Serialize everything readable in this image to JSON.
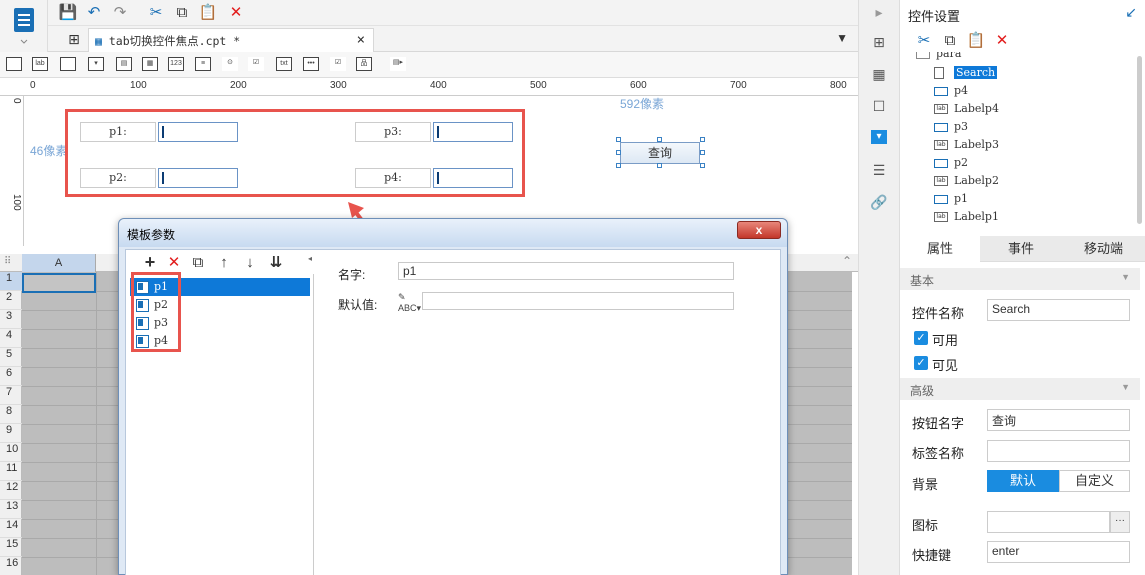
{
  "document_tab": {
    "label": "tab切换控件焦点.cpt *",
    "close": "×"
  },
  "ruler": {
    "ticks": [
      "0",
      "100",
      "200",
      "300",
      "400",
      "500",
      "600",
      "700",
      "800"
    ],
    "vticks": [
      "0",
      "100"
    ]
  },
  "design": {
    "hint_width": "592像素",
    "hint_height": "46像素",
    "params": [
      {
        "label": "p1:"
      },
      {
        "label": "p3:"
      },
      {
        "label": "p2:"
      },
      {
        "label": "p4:"
      }
    ],
    "query_button": "查询"
  },
  "grid": {
    "column": "A",
    "rows": [
      "1",
      "2",
      "3",
      "4",
      "5",
      "6",
      "7",
      "8",
      "9",
      "10",
      "11",
      "12",
      "13",
      "14",
      "15",
      "16"
    ]
  },
  "dialog": {
    "title": "模板参数",
    "close": "x",
    "params": [
      "p1",
      "p2",
      "p3",
      "p4"
    ],
    "name_label": "名字:",
    "name_value": "p1",
    "default_label": "默认值:",
    "default_value": ""
  },
  "right_panel": {
    "title": "控件设置",
    "tree": [
      "para",
      "Search",
      "p4",
      "Labelp4",
      "p3",
      "Labelp3",
      "p2",
      "Labelp2",
      "p1",
      "Labelp1"
    ],
    "tabs": [
      "属性",
      "事件",
      "移动端"
    ],
    "section_basic": "基本",
    "control_name_label": "控件名称",
    "control_name_value": "Search",
    "enabled_label": "可用",
    "visible_label": "可见",
    "section_advanced": "高级",
    "button_name_label": "按钮名字",
    "button_name_value": "查询",
    "tag_name_label": "标签名称",
    "tag_name_value": "",
    "background_label": "背景",
    "bg_default": "默认",
    "bg_custom": "自定义",
    "icon_label": "图标",
    "icon_value": "",
    "icon_more": "···",
    "hotkey_label": "快捷键",
    "hotkey_value": "enter"
  }
}
